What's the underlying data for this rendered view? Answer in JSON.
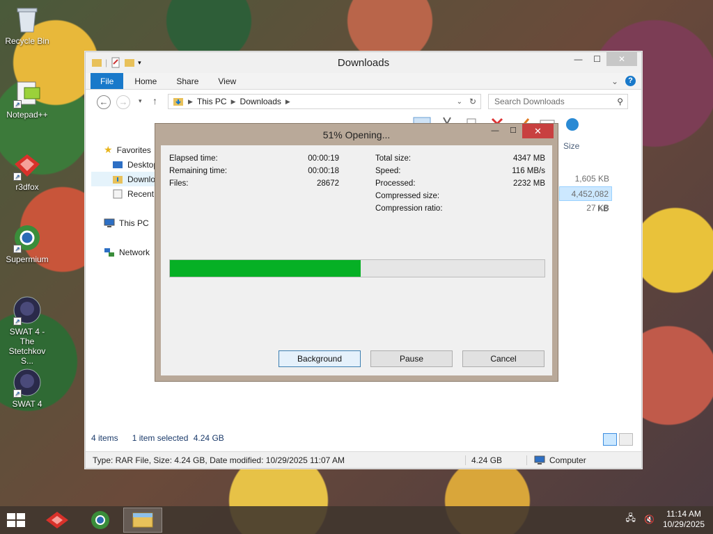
{
  "desktop": {
    "icons": [
      {
        "label": "Recycle Bin",
        "icon": "recycle-bin-icon"
      },
      {
        "label": "Notepad++",
        "icon": "notepad-plus-plus-icon"
      },
      {
        "label": "r3dfox",
        "icon": "r3dfox-icon"
      },
      {
        "label": "Supermium",
        "icon": "supermium-icon"
      },
      {
        "label": "SWAT 4 - The Stetchkov S...",
        "icon": "swat4-tss-icon"
      },
      {
        "label": "SWAT 4",
        "icon": "swat4-icon"
      }
    ]
  },
  "explorer": {
    "title": "Downloads",
    "tabs": {
      "file": "File",
      "home": "Home",
      "share": "Share",
      "view": "View"
    },
    "address": {
      "part1": "This PC",
      "part2": "Downloads"
    },
    "search_placeholder": "Search Downloads",
    "nav": {
      "favorites": "Favorites",
      "desktop": "Desktop",
      "downloads": "Downloads",
      "recent": "Recent places",
      "this_pc": "This PC",
      "network": "Network"
    },
    "column_size": "Size",
    "sizes": [
      "1,605 KB",
      "4,452,082 KB",
      "27 KB"
    ],
    "status": {
      "items": "4 items",
      "selected": "1 item selected",
      "selected_size": "4.24 GB"
    },
    "footer": {
      "details": "Type: RAR File, Size: 4.24 GB, Date modified: 10/29/2025 11:07 AM",
      "size": "4.24 GB",
      "location": "Computer"
    }
  },
  "dialog": {
    "title": "51% Opening...",
    "progress_percent": 51,
    "left": [
      {
        "label": "Elapsed time:",
        "value": "00:00:19"
      },
      {
        "label": "Remaining time:",
        "value": "00:00:18"
      },
      {
        "label": "Files:",
        "value": "28672"
      }
    ],
    "right": [
      {
        "label": "Total size:",
        "value": "4347 MB"
      },
      {
        "label": "Speed:",
        "value": "116 MB/s"
      },
      {
        "label": "Processed:",
        "value": "2232 MB"
      },
      {
        "label": "Compressed size:",
        "value": ""
      },
      {
        "label": "Compression ratio:",
        "value": ""
      }
    ],
    "buttons": {
      "background": "Background",
      "pause": "Pause",
      "cancel": "Cancel"
    }
  },
  "taskbar": {
    "clock_time": "11:14 AM",
    "clock_date": "10/29/2025"
  },
  "colors": {
    "accent": "#1979ca",
    "progress": "#06b025",
    "dialog_close": "#c84040"
  }
}
